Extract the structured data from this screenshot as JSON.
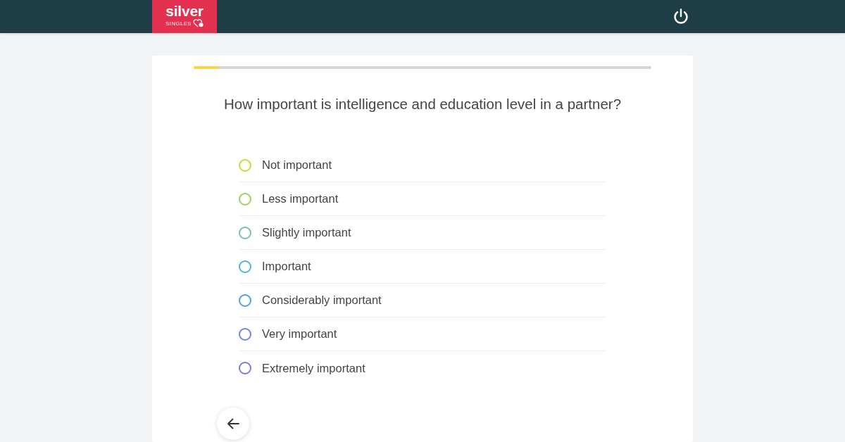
{
  "header": {
    "logo": {
      "wordmark": "silver",
      "tagline": "SINGLES"
    }
  },
  "progress": {
    "level": 0.055
  },
  "question": "How important is intelligence and education level in a partner?",
  "options": [
    {
      "label": "Not important",
      "color": "#c6dc2c",
      "selected": false
    },
    {
      "label": "Less important",
      "color": "#9bd05a",
      "selected": false
    },
    {
      "label": "Slightly important",
      "color": "#72c2a4",
      "selected": false
    },
    {
      "label": "Important",
      "color": "#4db6d6",
      "selected": false
    },
    {
      "label": "Considerably important",
      "color": "#4f9fe6",
      "selected": false
    },
    {
      "label": "Very important",
      "color": "#6a87e2",
      "selected": false
    },
    {
      "label": "Extremely important",
      "color": "#7c79dc",
      "selected": false
    }
  ]
}
